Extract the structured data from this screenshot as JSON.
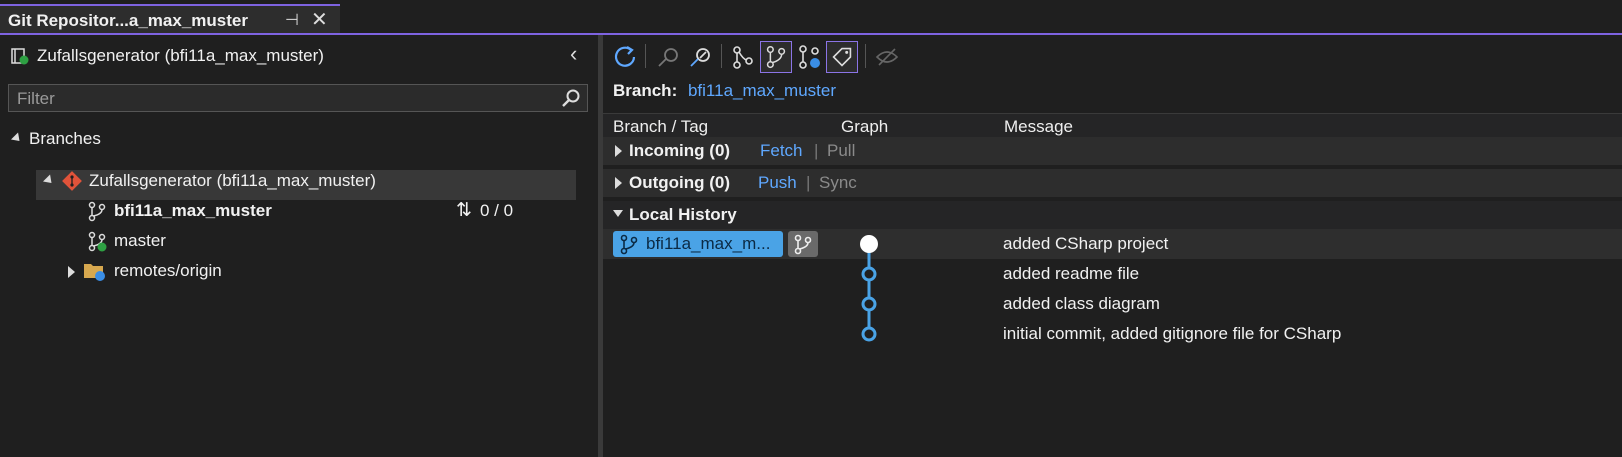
{
  "tab": {
    "title": "Git Repositor...a_max_muster",
    "pin_glyph": "⊣",
    "close_glyph": "✕"
  },
  "left": {
    "repo_title": "Zufallsgenerator (bfi11a_max_muster)",
    "filter_placeholder": "Filter",
    "branches_label": "Branches",
    "repo_node": "Zufallsgenerator (bfi11a_max_muster)",
    "branches": [
      {
        "name": "bfi11a_max_muster",
        "current": true,
        "sync": "0 / 0"
      },
      {
        "name": "master",
        "current": false
      }
    ],
    "remotes_label": "remotes/origin"
  },
  "right": {
    "branch_key": "Branch:",
    "branch_value": "bfi11a_max_muster",
    "columns": {
      "branch_tag": "Branch / Tag",
      "graph": "Graph",
      "message": "Message"
    },
    "incoming": {
      "label": "Incoming (0)",
      "fetch": "Fetch",
      "sep": "|",
      "pull": "Pull"
    },
    "outgoing": {
      "label": "Outgoing (0)",
      "push": "Push",
      "sep": "|",
      "sync": "Sync"
    },
    "local_history": "Local History",
    "branch_badge": "bfi11a_max_m...",
    "commits": [
      {
        "message": "added CSharp project",
        "head": true
      },
      {
        "message": "added readme file",
        "head": false
      },
      {
        "message": "added class diagram",
        "head": false
      },
      {
        "message": "initial commit, added gitignore file for CSharp",
        "head": false
      }
    ]
  },
  "colors": {
    "accent": "#7e63e1",
    "link": "#5fa8ff",
    "badge": "#4aa3e6",
    "graph_line": "#4aa3e6",
    "disabled": "#8a8a8a"
  }
}
